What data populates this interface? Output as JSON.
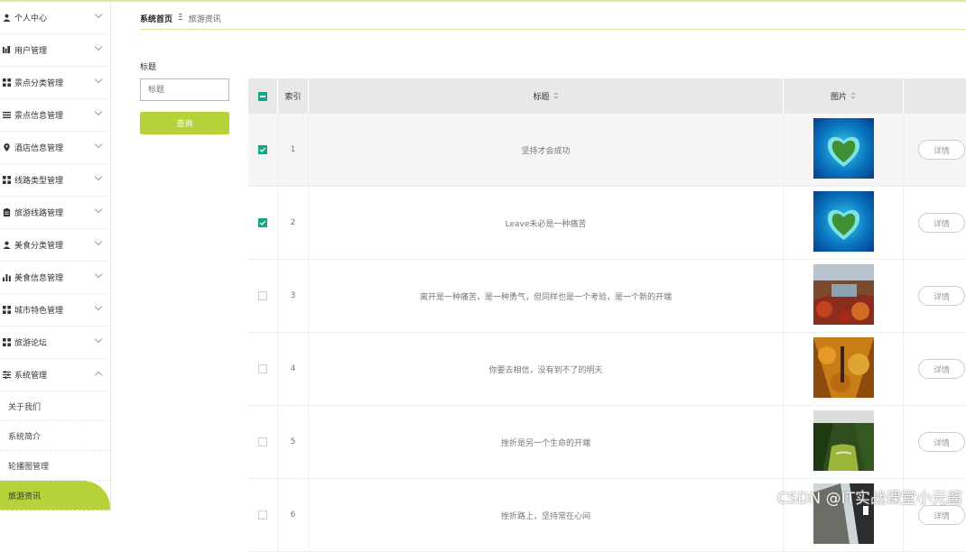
{
  "sidebar": {
    "items": [
      {
        "label": "个人中心",
        "icon": "person-icon"
      },
      {
        "label": "用户管理",
        "icon": "users-icon"
      },
      {
        "label": "景点分类管理",
        "icon": "grid-icon"
      },
      {
        "label": "景点信息管理",
        "icon": "list-icon"
      },
      {
        "label": "酒店信息管理",
        "icon": "location-pin-icon"
      },
      {
        "label": "线路类型管理",
        "icon": "grid-icon"
      },
      {
        "label": "旅游线路管理",
        "icon": "clipboard-icon"
      },
      {
        "label": "美食分类管理",
        "icon": "person-icon"
      },
      {
        "label": "美食信息管理",
        "icon": "bar-chart-icon"
      },
      {
        "label": "城市特色管理",
        "icon": "grid-icon"
      },
      {
        "label": "旅游论坛",
        "icon": "grid-icon"
      },
      {
        "label": "系统管理",
        "icon": "sliders-icon"
      }
    ],
    "sub_items": [
      {
        "label": "关于我们"
      },
      {
        "label": "系统简介"
      },
      {
        "label": "轮播图管理"
      },
      {
        "label": "旅游资讯"
      }
    ]
  },
  "breadcrumb": {
    "home": "系统首页",
    "separator": "Ξ",
    "current": "旅游资讯"
  },
  "search": {
    "label": "标题",
    "placeholder": "标题",
    "button": "查询"
  },
  "table": {
    "headers": {
      "index": "索引",
      "title": "标题",
      "image": "图片"
    },
    "detail_label": "详情",
    "rows": [
      {
        "index": "1",
        "title": "坚持才会成功",
        "checked": true,
        "image": "island"
      },
      {
        "index": "2",
        "title": "Leave未必是一种痛苦",
        "checked": true,
        "image": "island"
      },
      {
        "index": "3",
        "title": "离开是一种痛苦，是一种勇气，但同样也是一个考验，是一个新的开端",
        "checked": false,
        "image": "autumn-valley"
      },
      {
        "index": "4",
        "title": "你要去相信，没有到不了的明天",
        "checked": false,
        "image": "golden-forest"
      },
      {
        "index": "5",
        "title": "挫折是另一个生命的开端",
        "checked": false,
        "image": "green-canyon"
      },
      {
        "index": "6",
        "title": "挫折路上，坚持常在心间",
        "checked": false,
        "image": "cliff"
      }
    ]
  },
  "watermark": "CSDN @IT实战课堂小元酱",
  "colors": {
    "accent": "#b7d33a",
    "checkbox": "#17a589"
  }
}
